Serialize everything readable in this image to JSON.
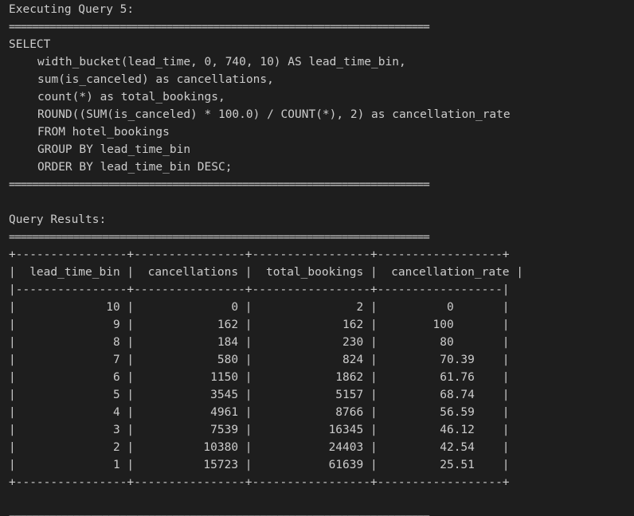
{
  "header": "Executing Query 5:",
  "separator": "========================================================================",
  "sql": [
    "SELECT",
    "width_bucket(lead_time, 0, 740, 10) AS lead_time_bin,",
    "sum(is_canceled) as cancellations,",
    "count(*) as total_bookings,",
    "ROUND((SUM(is_canceled) * 100.0) / COUNT(*), 2) as cancellation_rate",
    "FROM hotel_bookings",
    "GROUP BY lead_time_bin",
    "ORDER BY lead_time_bin DESC;"
  ],
  "results_label": "Query Results:",
  "table": {
    "border_top": "+----------------+----------------+-----------------+------------------+",
    "header_line": "|  lead_time_bin |  cancellations |  total_bookings |  cancellation_rate |",
    "header_sep": "|----------------+----------------+-----------------+------------------|",
    "columns": [
      "lead_time_bin",
      "cancellations",
      "total_bookings",
      "cancellation_rate"
    ],
    "rows": [
      "|             10 |              0 |               2 |          0       |",
      "|              9 |            162 |             162 |        100       |",
      "|              8 |            184 |             230 |         80       |",
      "|              7 |            580 |             824 |         70.39    |",
      "|              6 |           1150 |            1862 |         61.76    |",
      "|              5 |           3545 |            5157 |         68.74    |",
      "|              4 |           4961 |            8766 |         56.59    |",
      "|              3 |           7539 |           16345 |         46.12    |",
      "|              2 |          10380 |           24403 |         42.54    |",
      "|              1 |          15723 |           61639 |         25.51    |"
    ],
    "border_bottom": "+----------------+----------------+-----------------+------------------+"
  }
}
